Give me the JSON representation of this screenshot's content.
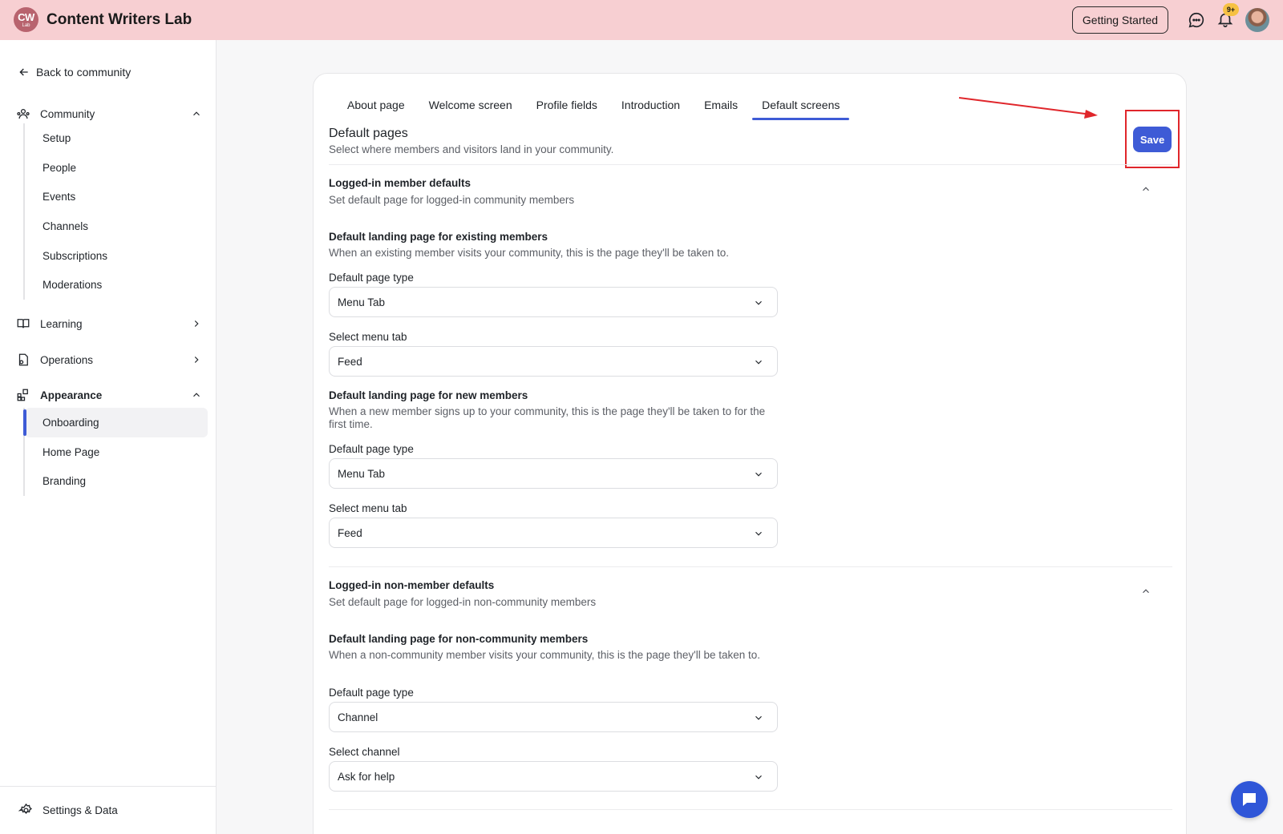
{
  "app": {
    "logo_top": "CW",
    "logo_bottom": "Lab",
    "title": "Content Writers Lab",
    "getting_started": "Getting Started",
    "notification_count": "9+"
  },
  "sidebar": {
    "back": "Back to community",
    "sections": {
      "community": "Community",
      "learning": "Learning",
      "operations": "Operations",
      "appearance": "Appearance"
    },
    "community_items": [
      "Setup",
      "People",
      "Events",
      "Channels",
      "Subscriptions",
      "Moderations"
    ],
    "appearance_items": [
      "Onboarding",
      "Home Page",
      "Branding"
    ],
    "active_item": "Onboarding",
    "footer": "Settings & Data"
  },
  "tabs": [
    "About page",
    "Welcome screen",
    "Profile fields",
    "Introduction",
    "Emails",
    "Default screens"
  ],
  "active_tab": "Default screens",
  "page": {
    "heading": "Default pages",
    "subheading": "Select where members and visitors land in your community.",
    "save_label": "Save"
  },
  "member_defaults": {
    "title": "Logged-in member defaults",
    "subtitle": "Set default page for logged-in community members",
    "existing": {
      "title": "Default landing page for existing members",
      "desc": "When an existing member visits your community, this is the page they'll be taken to.",
      "type_label": "Default page type",
      "type_value": "Menu Tab",
      "tab_label": "Select menu tab",
      "tab_value": "Feed"
    },
    "new": {
      "title": "Default landing page for new members",
      "desc": "When a new member signs up to your community, this is the page they'll be taken to for the first time.",
      "type_label": "Default page type",
      "type_value": "Menu Tab",
      "tab_label": "Select menu tab",
      "tab_value": "Feed"
    }
  },
  "non_member_defaults": {
    "title": "Logged-in non-member defaults",
    "subtitle": "Set default page for logged-in non-community members",
    "field": {
      "title": "Default landing page for non-community members",
      "desc": "When a non-community member visits your community, this is the page they'll be taken to.",
      "type_label": "Default page type",
      "type_value": "Channel",
      "channel_label": "Select channel",
      "channel_value": "Ask for help"
    }
  },
  "colors": {
    "topbar": "#f7cfd2",
    "accent": "#3e5bd6",
    "annotation": "#e0262b"
  }
}
